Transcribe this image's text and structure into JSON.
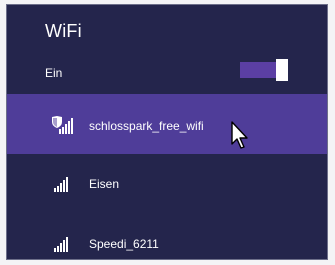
{
  "title": "WiFi",
  "toggle": {
    "label": "Ein",
    "state": "on"
  },
  "networks": [
    {
      "name": "schlosspark_free_wifi",
      "signal_bars": 5,
      "secured": true,
      "selected": true
    },
    {
      "name": "Eisen",
      "signal_bars": 5,
      "secured": false,
      "selected": false
    },
    {
      "name": "Speedi_6211",
      "signal_bars": 5,
      "secured": false,
      "selected": false
    }
  ],
  "colors": {
    "panel": "#24254c",
    "selected": "#4f3d99",
    "toggle_track": "#5b3fa4",
    "text": "#ffffff"
  }
}
